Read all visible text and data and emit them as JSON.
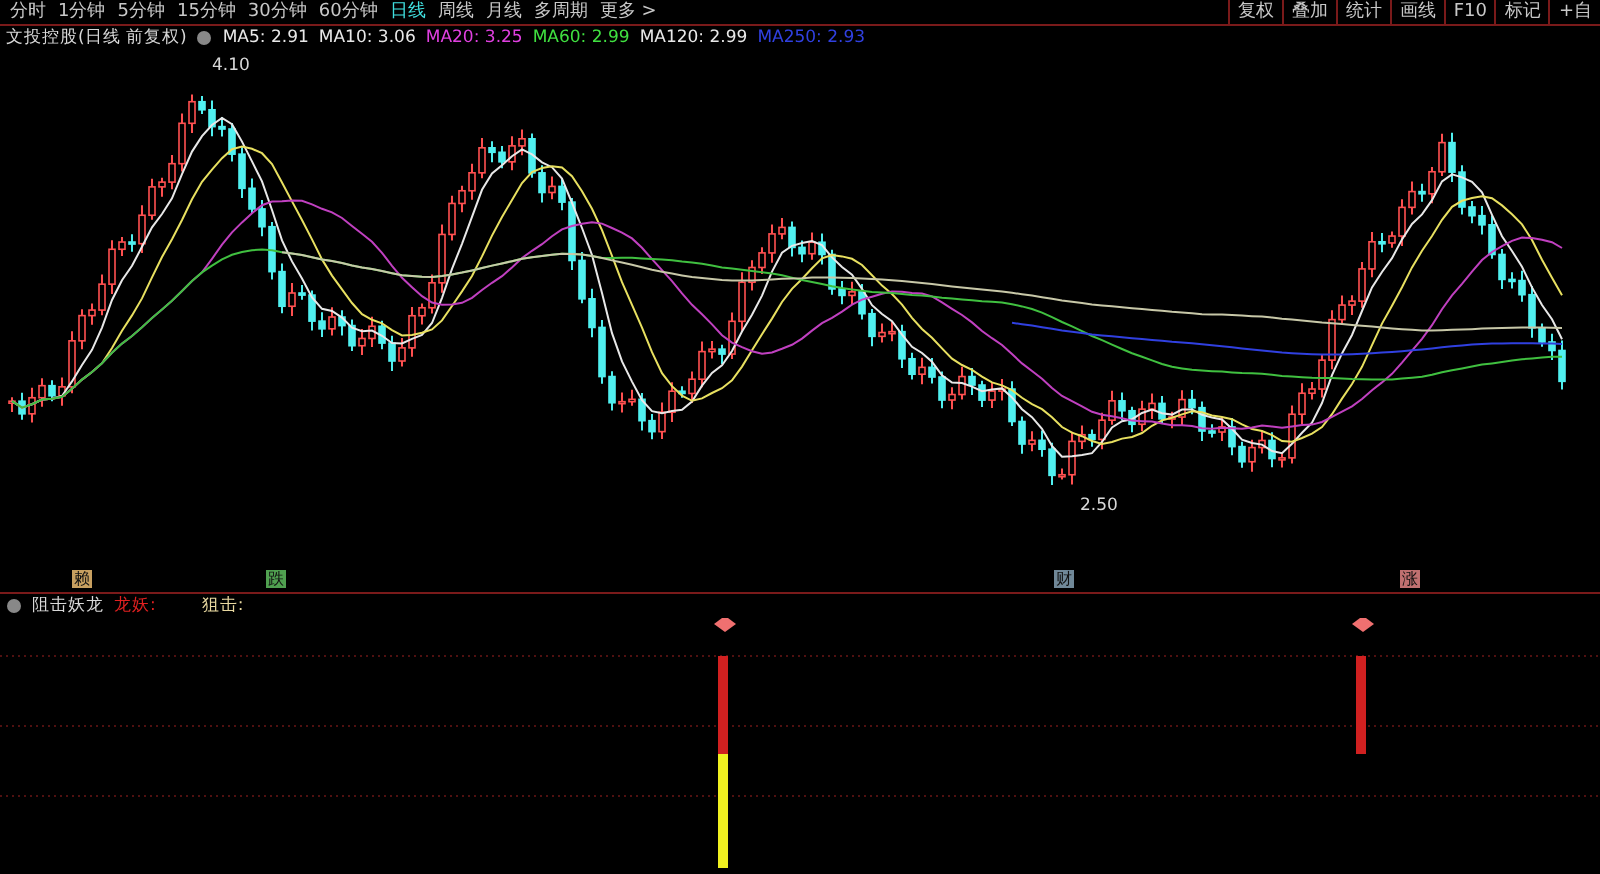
{
  "period_tabs": [
    {
      "label": "分时",
      "selected": false
    },
    {
      "label": "1分钟",
      "selected": false
    },
    {
      "label": "5分钟",
      "selected": false
    },
    {
      "label": "15分钟",
      "selected": false
    },
    {
      "label": "30分钟",
      "selected": false
    },
    {
      "label": "60分钟",
      "selected": false
    },
    {
      "label": "日线",
      "selected": true
    },
    {
      "label": "周线",
      "selected": false
    },
    {
      "label": "月线",
      "selected": false
    },
    {
      "label": "多周期",
      "selected": false
    },
    {
      "label": "更多 >",
      "selected": false
    }
  ],
  "tool_buttons": [
    "复权",
    "叠加",
    "统计",
    "画线",
    "F10",
    "标记",
    "+自"
  ],
  "main_chart": {
    "title": "文投控股(日线 前复权)",
    "indicators": [
      {
        "label": "MA5: 2.91",
        "color": "#e8e8e8"
      },
      {
        "label": "MA10: 3.06",
        "color": "#e8e8e8"
      },
      {
        "label": "MA20: 3.25",
        "color": "#e040e0"
      },
      {
        "label": "MA60: 2.99",
        "color": "#40e040"
      },
      {
        "label": "MA120: 2.99",
        "color": "#e8e8e8"
      },
      {
        "label": "MA250: 2.93",
        "color": "#3040e0"
      }
    ],
    "high_label": "4.10",
    "low_label": "2.50",
    "markers": [
      {
        "text": "赖",
        "color": "#c8a060"
      },
      {
        "text": "跌",
        "color": "#50a050"
      },
      {
        "text": "财",
        "color": "#708898"
      },
      {
        "text": "涨",
        "color": "#c07070"
      }
    ]
  },
  "sub_chart": {
    "title": "阻击妖龙",
    "lines": [
      {
        "label": "龙妖:",
        "color": "#e02020"
      },
      {
        "label": "狙击:",
        "color": "#e8d8a0"
      }
    ]
  }
}
